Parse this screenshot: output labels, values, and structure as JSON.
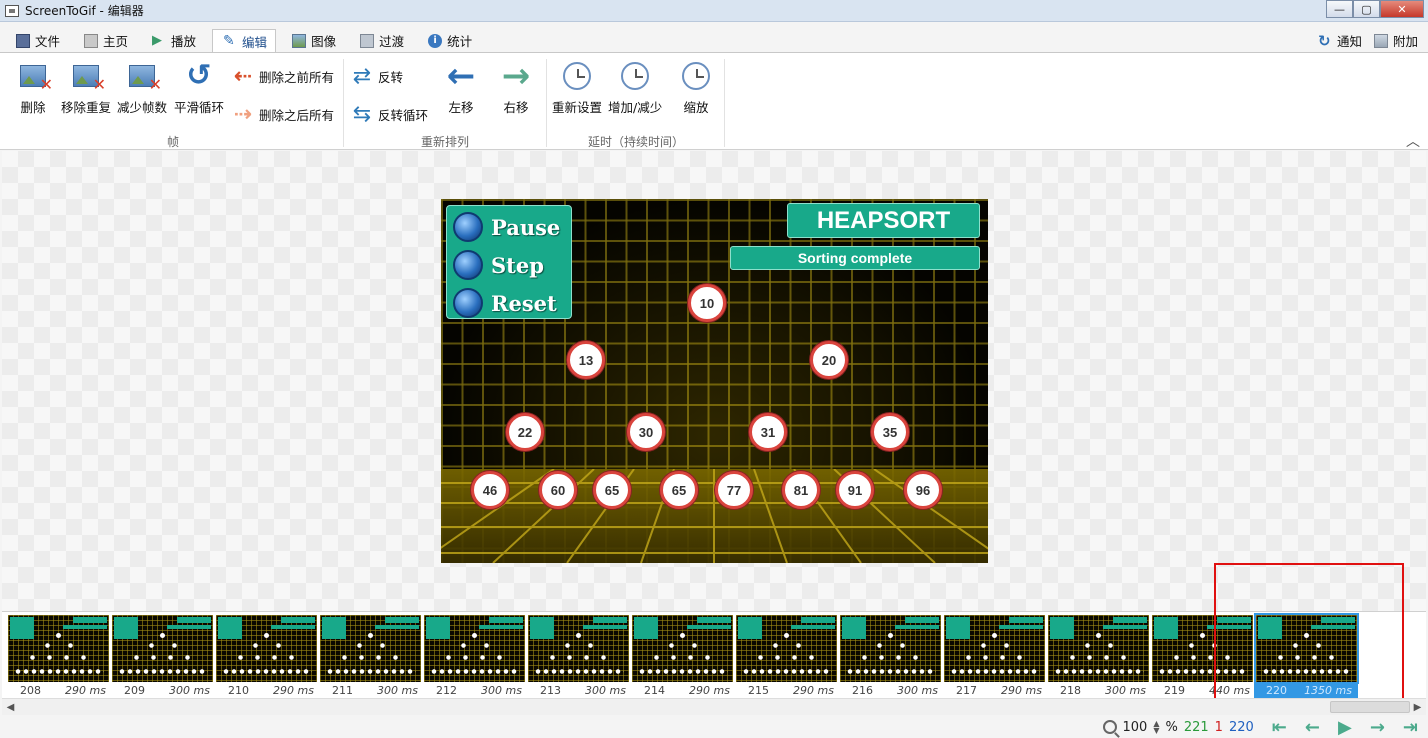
{
  "window": {
    "title": "ScreenToGif - 编辑器",
    "minimize": "—",
    "maximize": "▢",
    "close": "✕"
  },
  "tabs": [
    {
      "label": "文件"
    },
    {
      "label": "主页"
    },
    {
      "label": "播放"
    },
    {
      "label": "编辑"
    },
    {
      "label": "图像"
    },
    {
      "label": "过渡"
    },
    {
      "label": "统计"
    }
  ],
  "tabs_right": {
    "notify": "通知",
    "extras": "附加"
  },
  "ribbon": {
    "frames_group": {
      "label": "帧",
      "delete": "删除",
      "remove_duplicates": "移除重复",
      "reduce_frames": "减少帧数",
      "smooth_loop": "平滑循环",
      "delete_previous": "删除之前所有",
      "delete_next": "删除之后所有"
    },
    "reorder_group": {
      "label": "重新排列",
      "reverse": "反转",
      "yoyo": "反转循环",
      "move_left": "左移",
      "move_right": "右移"
    },
    "delay_group": {
      "label": "延时（持续时间）",
      "override": "重新设置",
      "increase_decrease": "增加/减少",
      "scale": "缩放"
    }
  },
  "preview": {
    "controls": [
      "Pause",
      "Step",
      "Reset"
    ],
    "title": "HEAPSORT",
    "status": "Sorting complete",
    "nodes": [
      "10",
      "13",
      "20",
      "22",
      "30",
      "31",
      "35",
      "46",
      "60",
      "65",
      "65",
      "77",
      "81",
      "91",
      "96"
    ]
  },
  "filmstrip": [
    {
      "num": "208",
      "ms": "290 ms"
    },
    {
      "num": "209",
      "ms": "300 ms"
    },
    {
      "num": "210",
      "ms": "290 ms"
    },
    {
      "num": "211",
      "ms": "300 ms"
    },
    {
      "num": "212",
      "ms": "300 ms"
    },
    {
      "num": "213",
      "ms": "300 ms"
    },
    {
      "num": "214",
      "ms": "290 ms"
    },
    {
      "num": "215",
      "ms": "290 ms"
    },
    {
      "num": "216",
      "ms": "300 ms"
    },
    {
      "num": "217",
      "ms": "290 ms"
    },
    {
      "num": "218",
      "ms": "300 ms"
    },
    {
      "num": "219",
      "ms": "440 ms"
    },
    {
      "num": "220",
      "ms": "1350 ms"
    }
  ],
  "statusbar": {
    "zoom": "100",
    "zoom_unit": "%",
    "frame_count": "221",
    "selected_count": "1",
    "current_frame": "220"
  }
}
